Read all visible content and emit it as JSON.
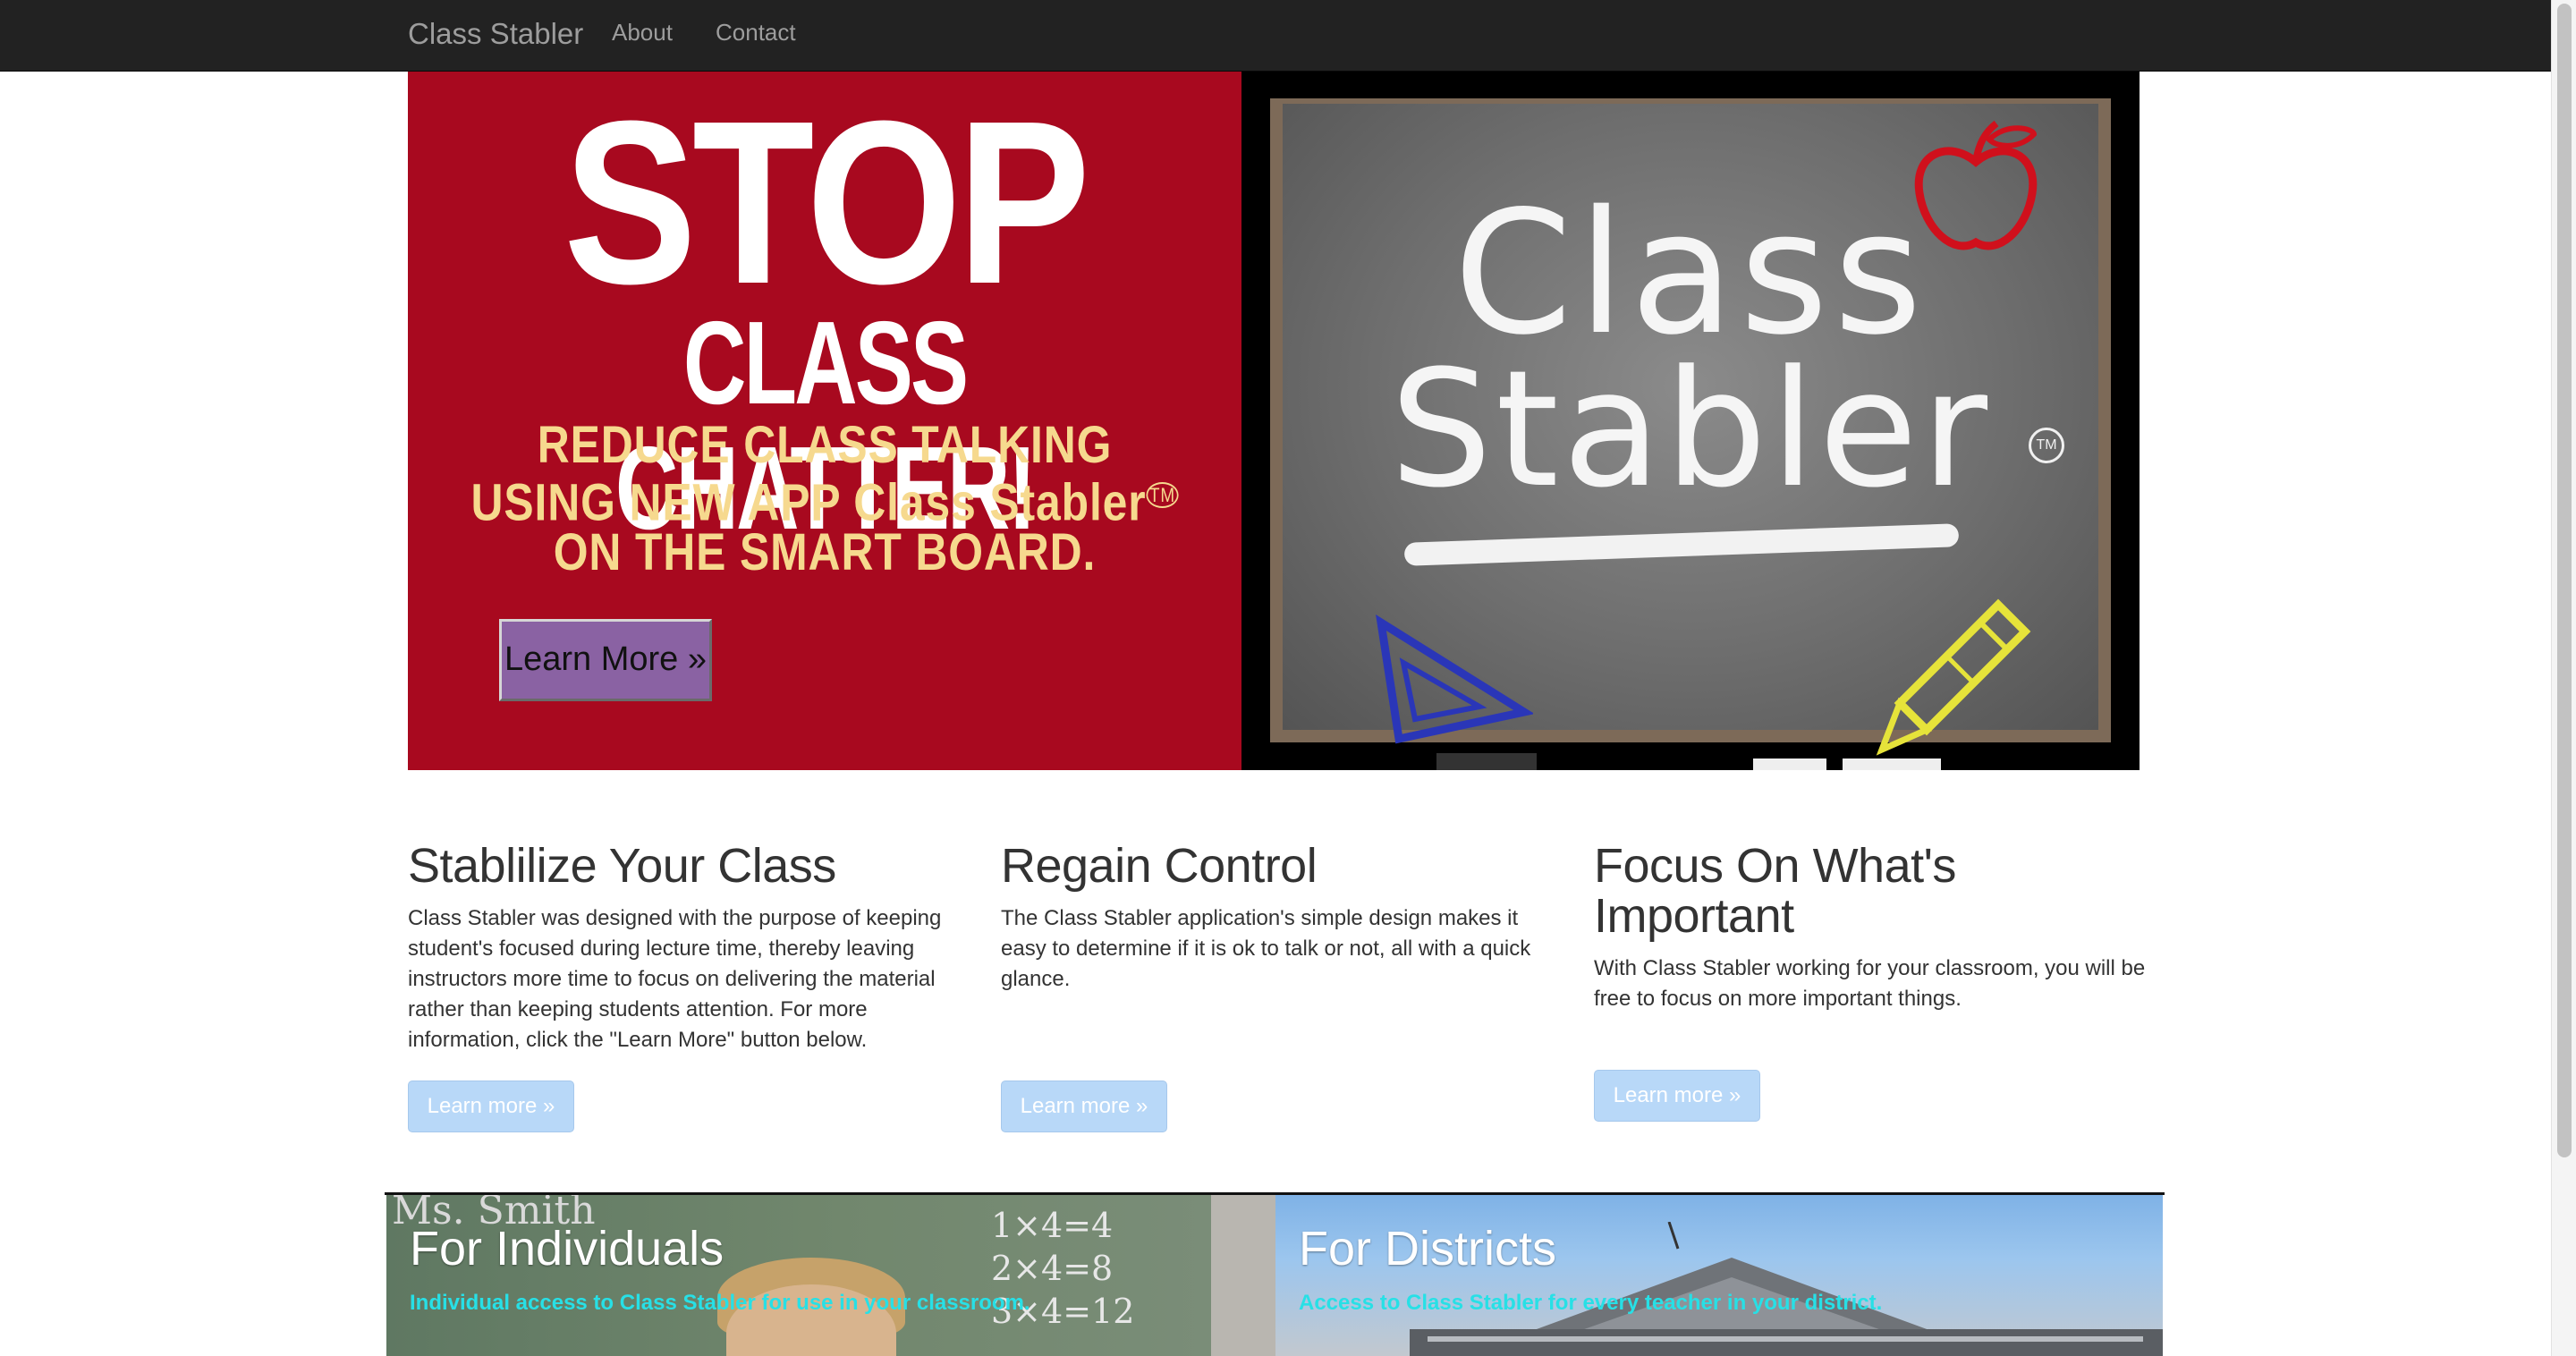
{
  "navbar": {
    "brand": "Class Stabler",
    "links": [
      "About",
      "Contact"
    ]
  },
  "hero": {
    "headline": "STOP",
    "subheadline": "CLASS CHATTER!",
    "tagline_lines": [
      "REDUCE CLASS TALKING",
      "USING NEW APP Class Stabler",
      "ON THE SMART BOARD."
    ],
    "tm": "TM",
    "cta": "Learn More »",
    "chalk_word_1": "Class",
    "chalk_word_2": "Stabler"
  },
  "features": [
    {
      "title": "Stablilize Your Class",
      "body": "Class Stabler was designed with the purpose of keeping student's focused during lecture time, thereby leaving instructors more time to focus on delivering the material rather than keeping students attention. For more information, click the \"Learn More\" button below.",
      "button": "Learn more »"
    },
    {
      "title": "Regain Control",
      "body": "The Class Stabler application's simple design makes it easy to determine if it is ok to talk or not, all with a quick glance.",
      "button": "Learn more »"
    },
    {
      "title": "Focus On What's Important",
      "body": "With Class Stabler working for your classroom, you will be free to focus on more important things.",
      "button": "Learn more »"
    }
  ],
  "tiles": [
    {
      "title": "For Individuals",
      "subtitle": "Individual access to Class Stabler for use in your classroom.",
      "chalk_name": "Ms. Smith",
      "chalk_math": [
        "1×4=4",
        "2×4=8",
        "3×4=12"
      ]
    },
    {
      "title": "For Districts",
      "subtitle": "Access to Class Stabler for every teacher in your district."
    }
  ],
  "colors": {
    "navbar_bg": "#222222",
    "hero_red": "#a8091f",
    "tagline_cream": "#f6d98e",
    "cta_purple": "#8a62a3",
    "learn_button_bg": "#b8d8f8",
    "tile_subtitle_cyan": "#27e0e6"
  }
}
